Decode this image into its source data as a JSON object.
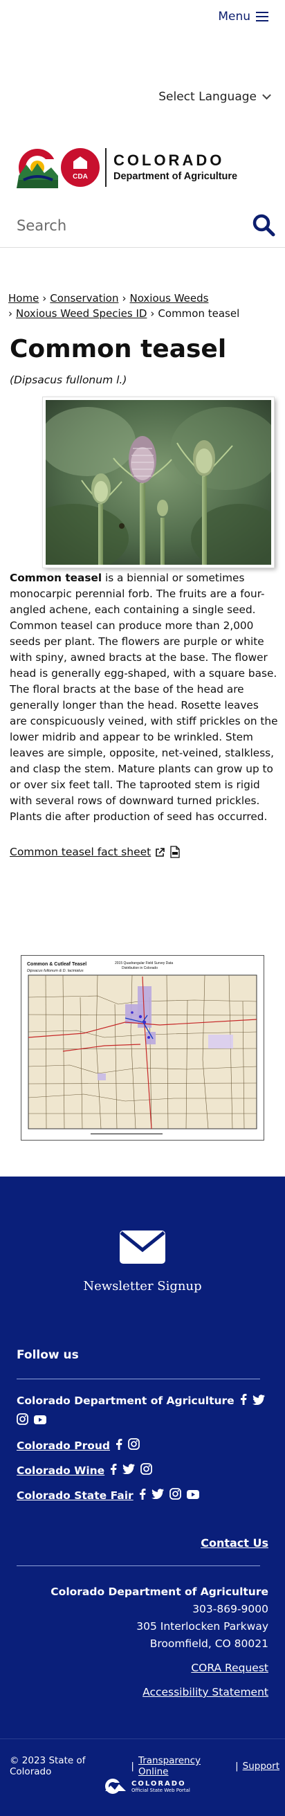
{
  "header": {
    "menu_label": "Menu"
  },
  "language": {
    "label": "Select Language"
  },
  "logo": {
    "line1": "COLORADO",
    "line2": "Department of Agriculture",
    "badge": "CDA"
  },
  "search": {
    "placeholder": "Search"
  },
  "breadcrumb": {
    "items": [
      "Home",
      "Conservation",
      "Noxious Weeds",
      "Noxious Weed Species ID"
    ],
    "current": "Common teasel"
  },
  "page": {
    "title": "Common teasel",
    "scientific_name": "(Dipsacus fullonum l.)",
    "lead": "Common teasel",
    "description": " is a biennial or sometimes monocarpic perennial forb. The fruits are a four-angled achene, each containing a single seed. Common teasel can produce more than 2,000 seeds per plant. The flowers are purple or white with spiny, awned bracts at the base. The flower head is generally egg-shaped, with a square base. The floral bracts at the base of the head are generally longer than the head. Rosette leaves are conspicuously veined, with stiff prickles on the lower midrib and appear to be wrinkled. Stem leaves are simple, opposite, net-veined, stalkless, and clasp the stem. Mature plants can grow up to or over six feet tall. The taprooted stem is rigid with several rows of downward turned prickles. Plants die after production of seed has occurred.",
    "factsheet_link": "Common teasel fact sheet"
  },
  "map": {
    "title": "Common & Cutleaf Teasel",
    "subtitle": "Dipsacus fullonum & D. laciniatus",
    "center_title": "2015 Quadrangular Field Survey Data",
    "center_sub": "Distribution in Colorado"
  },
  "footer": {
    "newsletter": "Newsletter Signup",
    "follow_us": "Follow us",
    "social": [
      {
        "name": "Colorado Department of Agriculture"
      },
      {
        "name": "Colorado Proud"
      },
      {
        "name": "Colorado Wine"
      },
      {
        "name": "Colorado State Fair"
      }
    ],
    "contact_us": "Contact Us",
    "org": "Colorado Department of Agriculture",
    "phone": "303-869-9000",
    "street": "305 Interlocken Parkway",
    "city": "Broomfield, CO 80021",
    "cora": "CORA Request",
    "accessibility": "Accessibility Statement",
    "copyright": "© 2023 State of Colorado",
    "transparency": "Transparency Online",
    "support": "Support",
    "portal_line1": "COLORADO",
    "portal_line2": "Official State Web Portal"
  },
  "colors": {
    "navy": "#0a1f7a",
    "brand_blue": "#0c1e6e",
    "cda_red": "#c8102e"
  }
}
